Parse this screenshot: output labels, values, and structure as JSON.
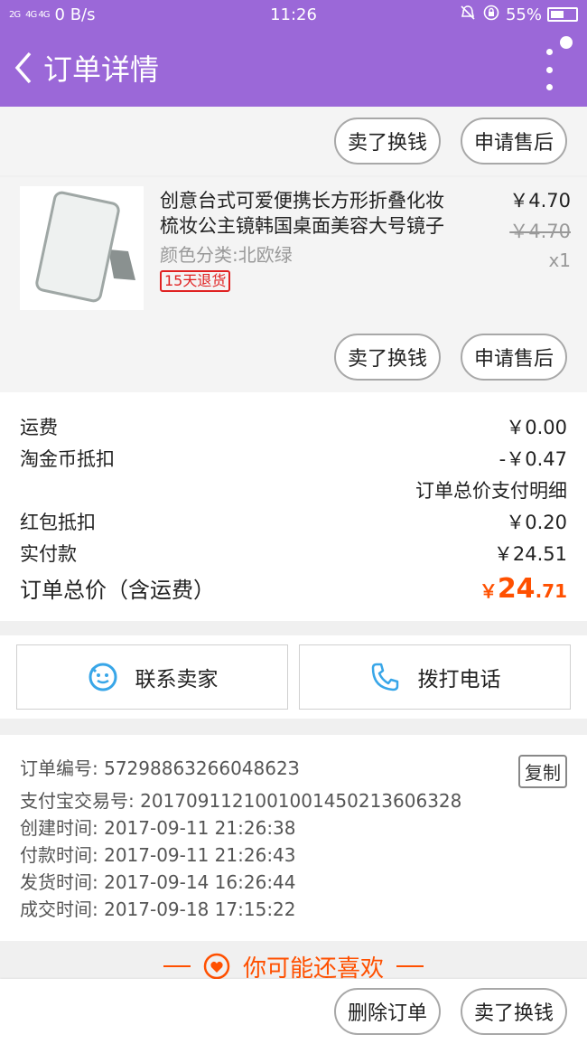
{
  "status_bar": {
    "signal": "2G",
    "network": "4G 4G",
    "speed": "0 B/s",
    "time": "11:26",
    "battery": "55%"
  },
  "header": {
    "title": "订单详情"
  },
  "top_actions": {
    "sell_label": "卖了换钱",
    "aftersale_label": "申请售后"
  },
  "item": {
    "title": "创意台式可爱便携长方形折叠化妆梳妆公主镜韩国桌面美容大号镜子",
    "spec": "颜色分类:北欧绿",
    "return_tag": "15天退货",
    "price": "￥4.70",
    "original_price": "￥4.70",
    "quantity": "x1",
    "sell_label": "卖了换钱",
    "aftersale_label": "申请售后"
  },
  "costs": {
    "shipping_label": "运费",
    "shipping_value": "￥0.00",
    "coin_label": "淘金币抵扣",
    "coin_value": "-￥0.47",
    "detail_link": "订单总价支付明细",
    "redpacket_label": "红包抵扣",
    "redpacket_value": "￥0.20",
    "paid_label": "实付款",
    "paid_value": "￥24.51",
    "total_label": "订单总价（含运费）",
    "total_symbol": "￥",
    "total_int": "24",
    "total_dec": ".71"
  },
  "contact": {
    "seller_label": "联系卖家",
    "phone_label": "拨打电话"
  },
  "order_info": {
    "order_no": "订单编号: 5729886326604862З",
    "alipay_no": "支付宝交易号: 2017091121001001450213606328",
    "created": "创建时间: 2017-09-11 21:26:38",
    "paid": "付款时间: 2017-09-11 21:26:43",
    "shipped": "发货时间: 2017-09-14 16:26:44",
    "completed": "成交时间: 2017-09-18 17:15:22",
    "copy_label": "复制"
  },
  "recommend": {
    "label": "你可能还喜欢"
  },
  "bottom_bar": {
    "delete_label": "删除订单",
    "sell_label": "卖了换钱"
  },
  "colors": {
    "accent": "#9b68d8",
    "price": "#ff5000",
    "return_tag": "#e02222",
    "contact_icon": "#38a6e8"
  }
}
